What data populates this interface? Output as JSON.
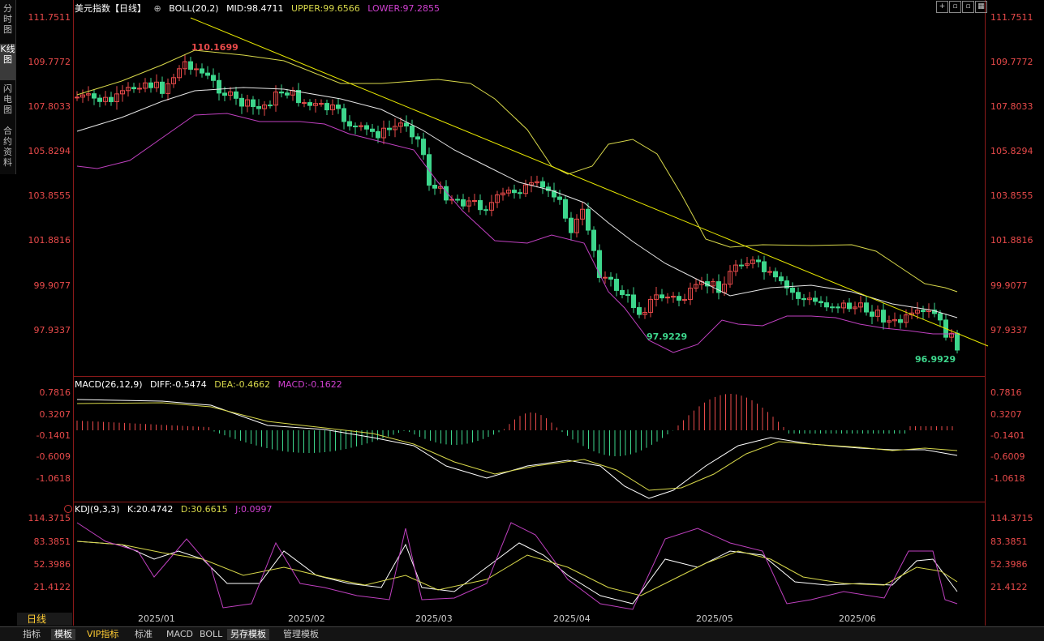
{
  "side_tabs": [
    "分时图",
    "K线图",
    "闪电图",
    "合约资料"
  ],
  "main": {
    "title": "美元指数【日线】",
    "boll_label": "BOLL(20,2)",
    "mid": "MID:98.4711",
    "upper": "UPPER:99.6566",
    "lower": "LOWER:97.2855",
    "price_levels": [
      "111.7511",
      "109.7772",
      "107.8033",
      "105.8294",
      "103.8555",
      "101.8816",
      "99.9077",
      "97.9337"
    ],
    "annotations": {
      "high": "110.1699",
      "low1": "97.9229",
      "low2": "96.9929"
    }
  },
  "macd": {
    "label": "MACD(26,12,9)",
    "diff": "DIFF:-0.5474",
    "dea": "DEA:-0.4662",
    "macd": "MACD:-0.1622",
    "levels": [
      "0.7816",
      "0.3207",
      "-0.1401",
      "-0.6009",
      "-1.0618"
    ]
  },
  "kdj": {
    "label": "KDJ(9,3,3)",
    "k": "K:20.4742",
    "d": "D:30.6615",
    "j": "J:0.0997",
    "levels": [
      "114.3715",
      "83.3851",
      "52.3986",
      "21.4122"
    ]
  },
  "x_dates": [
    "2025/01",
    "2025/02",
    "2025/03",
    "2025/04",
    "2025/05",
    "2025/06"
  ],
  "period": "日线",
  "bottom_buttons": [
    "指标",
    "模板",
    "VIP指标",
    "标准",
    "MACD",
    "BOLL",
    "另存模板",
    "管理模板"
  ],
  "colors": {
    "up": "#e84a4a",
    "down": "#3dd68c",
    "boll_outer": "#d8d84a",
    "boll_mid": "#e6e6e6",
    "trend": "#e6e600",
    "lower_band": "#c040c0"
  },
  "toolbar_icons": [
    "crosshair-icon",
    "window-icon",
    "window-icon",
    "grid-icon",
    "table-icon"
  ]
}
